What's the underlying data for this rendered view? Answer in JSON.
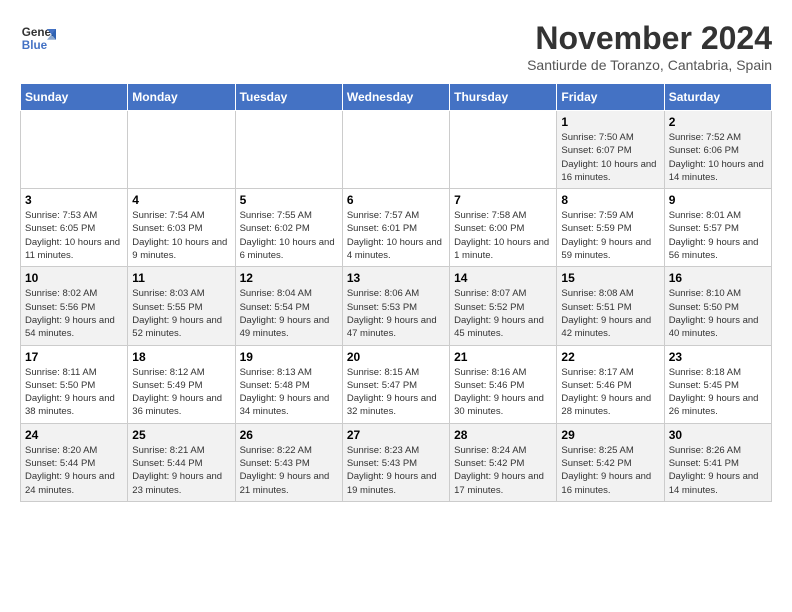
{
  "header": {
    "logo_line1": "General",
    "logo_line2": "Blue",
    "month_title": "November 2024",
    "location": "Santiurde de Toranzo, Cantabria, Spain"
  },
  "weekdays": [
    "Sunday",
    "Monday",
    "Tuesday",
    "Wednesday",
    "Thursday",
    "Friday",
    "Saturday"
  ],
  "weeks": [
    [
      {
        "day": "",
        "info": ""
      },
      {
        "day": "",
        "info": ""
      },
      {
        "day": "",
        "info": ""
      },
      {
        "day": "",
        "info": ""
      },
      {
        "day": "",
        "info": ""
      },
      {
        "day": "1",
        "info": "Sunrise: 7:50 AM\nSunset: 6:07 PM\nDaylight: 10 hours and 16 minutes."
      },
      {
        "day": "2",
        "info": "Sunrise: 7:52 AM\nSunset: 6:06 PM\nDaylight: 10 hours and 14 minutes."
      }
    ],
    [
      {
        "day": "3",
        "info": "Sunrise: 7:53 AM\nSunset: 6:05 PM\nDaylight: 10 hours and 11 minutes."
      },
      {
        "day": "4",
        "info": "Sunrise: 7:54 AM\nSunset: 6:03 PM\nDaylight: 10 hours and 9 minutes."
      },
      {
        "day": "5",
        "info": "Sunrise: 7:55 AM\nSunset: 6:02 PM\nDaylight: 10 hours and 6 minutes."
      },
      {
        "day": "6",
        "info": "Sunrise: 7:57 AM\nSunset: 6:01 PM\nDaylight: 10 hours and 4 minutes."
      },
      {
        "day": "7",
        "info": "Sunrise: 7:58 AM\nSunset: 6:00 PM\nDaylight: 10 hours and 1 minute."
      },
      {
        "day": "8",
        "info": "Sunrise: 7:59 AM\nSunset: 5:59 PM\nDaylight: 9 hours and 59 minutes."
      },
      {
        "day": "9",
        "info": "Sunrise: 8:01 AM\nSunset: 5:57 PM\nDaylight: 9 hours and 56 minutes."
      }
    ],
    [
      {
        "day": "10",
        "info": "Sunrise: 8:02 AM\nSunset: 5:56 PM\nDaylight: 9 hours and 54 minutes."
      },
      {
        "day": "11",
        "info": "Sunrise: 8:03 AM\nSunset: 5:55 PM\nDaylight: 9 hours and 52 minutes."
      },
      {
        "day": "12",
        "info": "Sunrise: 8:04 AM\nSunset: 5:54 PM\nDaylight: 9 hours and 49 minutes."
      },
      {
        "day": "13",
        "info": "Sunrise: 8:06 AM\nSunset: 5:53 PM\nDaylight: 9 hours and 47 minutes."
      },
      {
        "day": "14",
        "info": "Sunrise: 8:07 AM\nSunset: 5:52 PM\nDaylight: 9 hours and 45 minutes."
      },
      {
        "day": "15",
        "info": "Sunrise: 8:08 AM\nSunset: 5:51 PM\nDaylight: 9 hours and 42 minutes."
      },
      {
        "day": "16",
        "info": "Sunrise: 8:10 AM\nSunset: 5:50 PM\nDaylight: 9 hours and 40 minutes."
      }
    ],
    [
      {
        "day": "17",
        "info": "Sunrise: 8:11 AM\nSunset: 5:50 PM\nDaylight: 9 hours and 38 minutes."
      },
      {
        "day": "18",
        "info": "Sunrise: 8:12 AM\nSunset: 5:49 PM\nDaylight: 9 hours and 36 minutes."
      },
      {
        "day": "19",
        "info": "Sunrise: 8:13 AM\nSunset: 5:48 PM\nDaylight: 9 hours and 34 minutes."
      },
      {
        "day": "20",
        "info": "Sunrise: 8:15 AM\nSunset: 5:47 PM\nDaylight: 9 hours and 32 minutes."
      },
      {
        "day": "21",
        "info": "Sunrise: 8:16 AM\nSunset: 5:46 PM\nDaylight: 9 hours and 30 minutes."
      },
      {
        "day": "22",
        "info": "Sunrise: 8:17 AM\nSunset: 5:46 PM\nDaylight: 9 hours and 28 minutes."
      },
      {
        "day": "23",
        "info": "Sunrise: 8:18 AM\nSunset: 5:45 PM\nDaylight: 9 hours and 26 minutes."
      }
    ],
    [
      {
        "day": "24",
        "info": "Sunrise: 8:20 AM\nSunset: 5:44 PM\nDaylight: 9 hours and 24 minutes."
      },
      {
        "day": "25",
        "info": "Sunrise: 8:21 AM\nSunset: 5:44 PM\nDaylight: 9 hours and 23 minutes."
      },
      {
        "day": "26",
        "info": "Sunrise: 8:22 AM\nSunset: 5:43 PM\nDaylight: 9 hours and 21 minutes."
      },
      {
        "day": "27",
        "info": "Sunrise: 8:23 AM\nSunset: 5:43 PM\nDaylight: 9 hours and 19 minutes."
      },
      {
        "day": "28",
        "info": "Sunrise: 8:24 AM\nSunset: 5:42 PM\nDaylight: 9 hours and 17 minutes."
      },
      {
        "day": "29",
        "info": "Sunrise: 8:25 AM\nSunset: 5:42 PM\nDaylight: 9 hours and 16 minutes."
      },
      {
        "day": "30",
        "info": "Sunrise: 8:26 AM\nSunset: 5:41 PM\nDaylight: 9 hours and 14 minutes."
      }
    ]
  ]
}
